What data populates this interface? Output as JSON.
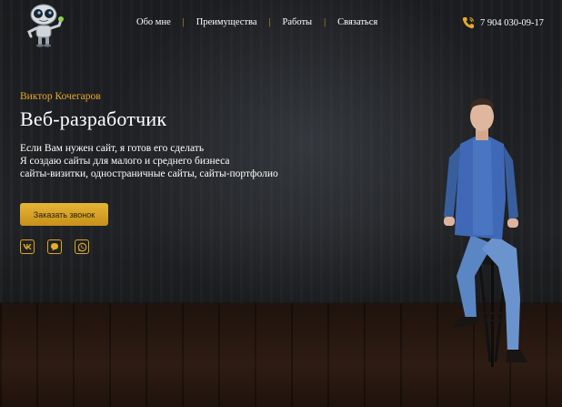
{
  "nav": {
    "items": [
      "Обо мне",
      "Преимущества",
      "Работы",
      "Связаться"
    ]
  },
  "contact": {
    "phone": "7 904 030-09-17"
  },
  "hero": {
    "name": "Виктор Кочегаров",
    "title": "Веб-разработчик",
    "lines": [
      "Если Вам нужен сайт, я готов его сделать",
      "Я создаю сайты для малого и среднего бизнеса",
      "сайты-визитки, одностраничные сайты, сайты-портфолио"
    ],
    "cta_label": "Заказать звонок"
  },
  "socials": [
    "vk-icon",
    "chat-icon",
    "whatsapp-icon"
  ],
  "colors": {
    "accent": "#e3ac2c",
    "background": "#1b1c1f"
  }
}
